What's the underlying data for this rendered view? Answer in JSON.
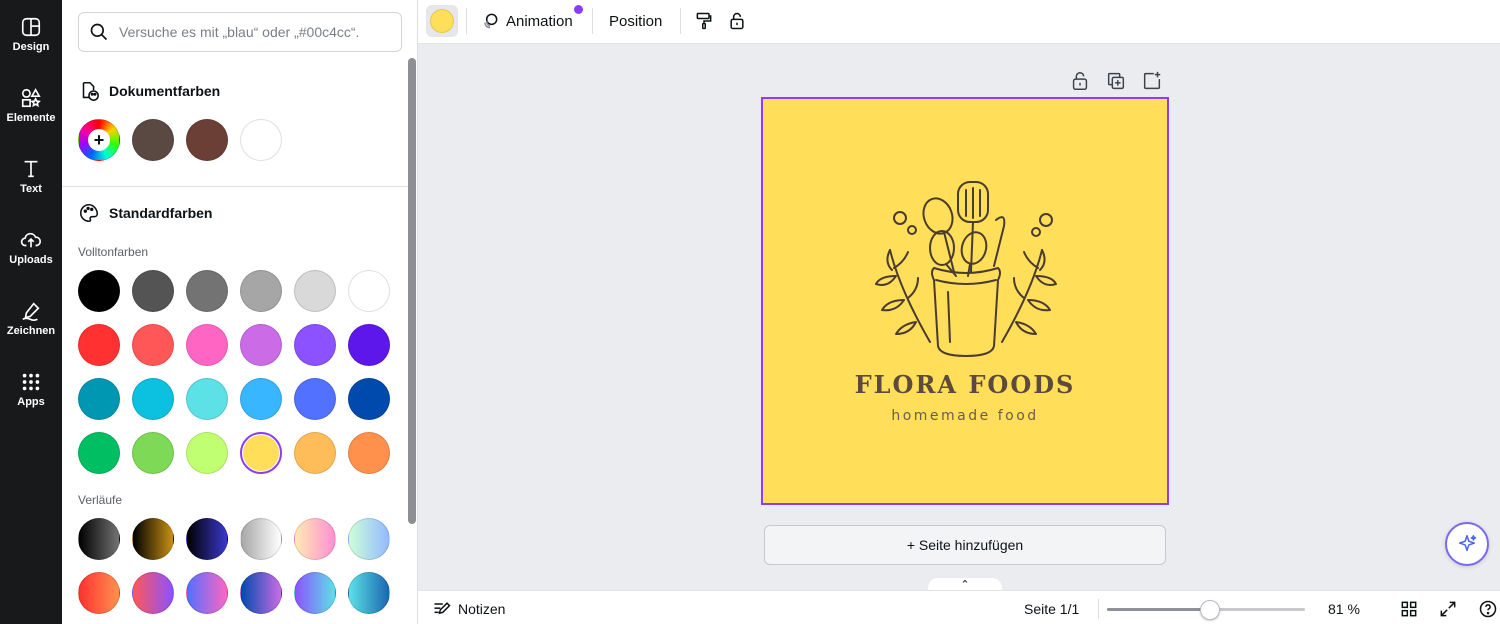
{
  "rail": {
    "items": [
      {
        "label": "Design",
        "icon": "design-icon"
      },
      {
        "label": "Elemente",
        "icon": "elements-icon"
      },
      {
        "label": "Text",
        "icon": "text-icon"
      },
      {
        "label": "Uploads",
        "icon": "upload-cloud-icon"
      },
      {
        "label": "Zeichnen",
        "icon": "draw-icon"
      },
      {
        "label": "Apps",
        "icon": "apps-grid-icon"
      }
    ]
  },
  "panel": {
    "search_placeholder": "Versuche es mit „blau“ oder „#00c4cc“.",
    "doc_colors_title": "Dokumentfarben",
    "doc_colors": [
      "#5a4842",
      "#6b3f36",
      "#ffffff"
    ],
    "default_colors_title": "Standardfarben",
    "solid_label": "Volltonfarben",
    "solid_colors": [
      [
        "#000000",
        "#545454",
        "#737373",
        "#a6a6a6",
        "#d9d9d9",
        "#ffffff"
      ],
      [
        "#ff3131",
        "#ff5757",
        "#ff66c4",
        "#cb6ce6",
        "#8c52ff",
        "#5e17eb"
      ],
      [
        "#0097b2",
        "#0cc0df",
        "#5ce1e6",
        "#38b6ff",
        "#5271ff",
        "#004aad"
      ],
      [
        "#00bf63",
        "#7ed957",
        "#c1ff72",
        "#ffde59",
        "#ffbd59",
        "#ff914d"
      ]
    ],
    "selected_color": "#ffde59",
    "gradients_label": "Verläufe",
    "gradients": [
      [
        "linear-gradient(90deg,#000000,#737373)",
        "linear-gradient(90deg,#000000,#c89116)",
        "linear-gradient(90deg,#000000,#3b38cc)",
        "linear-gradient(90deg,#a6a6a6,#ffffff)",
        "linear-gradient(90deg,#ffeab2,#ff8fd4)",
        "linear-gradient(90deg,#cdffd8,#94b9ff)"
      ],
      [
        "linear-gradient(90deg,#ff3131,#ff914d)",
        "linear-gradient(90deg,#ff5757,#8c52ff)",
        "linear-gradient(90deg,#5170ff,#ff66c4)",
        "linear-gradient(90deg,#004aad,#cb6ce6)",
        "linear-gradient(90deg,#8c52ff,#5ce1e6)",
        "linear-gradient(90deg,#5ce1e6,#1a66b0)"
      ]
    ]
  },
  "toolbar": {
    "current_color": "#ffde59",
    "animation_label": "Animation",
    "position_label": "Position"
  },
  "canvas": {
    "background": "#ffde59",
    "brand_title": "FLORA FOODS",
    "brand_subtitle": "homemade food",
    "add_page_label": "+ Seite hinzufügen",
    "collapse_glyph": "⌃"
  },
  "bottombar": {
    "notes_label": "Notizen",
    "page_count": "Seite 1/1",
    "zoom_percent": 81,
    "zoom_label": "81 %"
  },
  "colors": {
    "accent": "#8b3dff",
    "rail_bg": "#18191b"
  }
}
